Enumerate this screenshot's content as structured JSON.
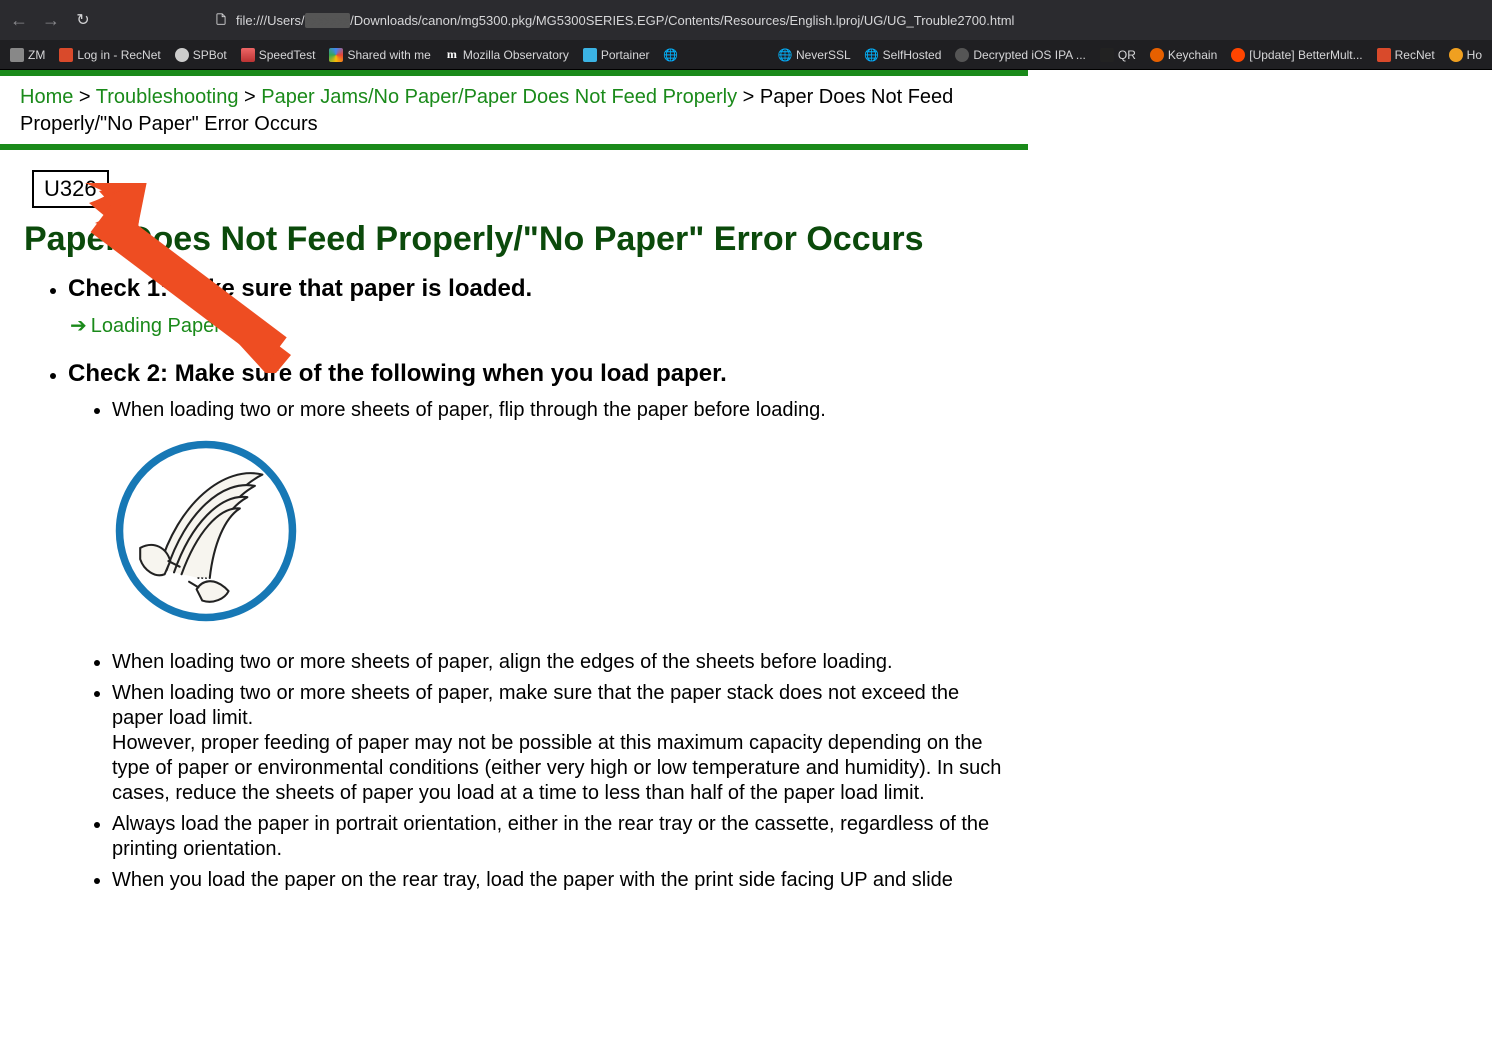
{
  "browser": {
    "url_prefix": "file:///Users/",
    "url_rest": "/Downloads/canon/mg5300.pkg/MG5300SERIES.EGP/Contents/Resources/English.lproj/UG/UG_Trouble2700.html",
    "bookmarks_left": [
      {
        "label": "ZM"
      },
      {
        "label": "Log in - RecNet"
      },
      {
        "label": "SPBot"
      },
      {
        "label": "SpeedTest"
      },
      {
        "label": "Shared with me"
      },
      {
        "label": "Mozilla Observatory"
      },
      {
        "label": "Portainer"
      }
    ],
    "bookmarks_right": [
      {
        "label": "NeverSSL"
      },
      {
        "label": "SelfHosted"
      },
      {
        "label": "Decrypted iOS IPA ..."
      },
      {
        "label": "QR"
      },
      {
        "label": "Keychain"
      },
      {
        "label": "[Update] BetterMult..."
      },
      {
        "label": "RecNet"
      },
      {
        "label": "Ho"
      }
    ]
  },
  "breadcrumb": {
    "home": "Home",
    "sep": " > ",
    "troubleshooting": "Troubleshooting",
    "paperjams": "Paper Jams/No Paper/Paper Does Not Feed Properly",
    "current": "Paper Does Not Feed Properly/\"No Paper\" Error Occurs"
  },
  "code": "U326",
  "page_title": "Paper Does Not Feed Properly/\"No Paper\" Error Occurs",
  "check1": {
    "title": "Check 1: Make sure that paper is loaded.",
    "link": "Loading Paper"
  },
  "check2": {
    "title": "Check 2: Make sure of the following when you load paper.",
    "items": [
      "When loading two or more sheets of paper, flip through the paper before loading.",
      "When loading two or more sheets of paper, align the edges of the sheets before loading.",
      "When loading two or more sheets of paper, make sure that the paper stack does not exceed the paper load limit.",
      "However, proper feeding of paper may not be possible at this maximum capacity depending on the type of paper or environmental conditions (either very high or low temperature and humidity). In such cases, reduce the sheets of paper you load at a time to less than half of the paper load limit.",
      "Always load the paper in portrait orientation, either in the rear tray or the cassette, regardless of the printing orientation.",
      "When you load the paper on the rear tray, load the paper with the print side facing UP and slide"
    ]
  }
}
